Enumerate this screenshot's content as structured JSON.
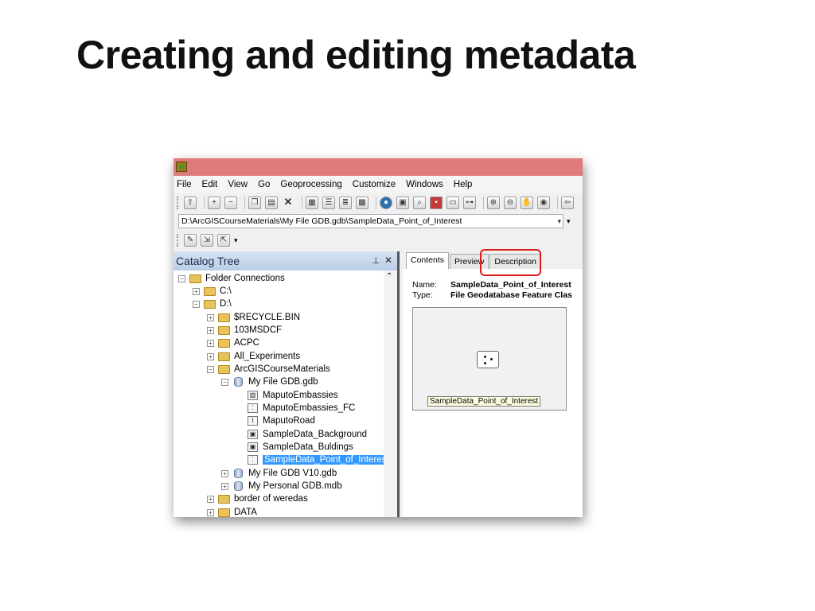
{
  "slide": {
    "title": "Creating and editing metadata"
  },
  "menu": [
    "File",
    "Edit",
    "View",
    "Go",
    "Geoprocessing",
    "Customize",
    "Windows",
    "Help"
  ],
  "location": {
    "path": "D:\\ArcGISCourseMaterials\\My File GDB.gdb\\SampleData_Point_of_Interest"
  },
  "catalog": {
    "title": "Catalog Tree",
    "items": [
      {
        "label": "Folder Connections"
      },
      {
        "label": "C:\\"
      },
      {
        "label": "D:\\"
      },
      {
        "label": "$RECYCLE.BIN"
      },
      {
        "label": "103MSDCF"
      },
      {
        "label": "ACPC"
      },
      {
        "label": "All_Experiments"
      },
      {
        "label": "ArcGISCourseMaterials"
      },
      {
        "label": "My File GDB.gdb"
      },
      {
        "label": "MaputoEmbassies"
      },
      {
        "label": "MaputoEmbassies_FC"
      },
      {
        "label": "MaputoRoad"
      },
      {
        "label": "SampleData_Background"
      },
      {
        "label": "SampleData_Buldings"
      },
      {
        "label": "SampleData_Point_of_Interest"
      },
      {
        "label": "My File GDB V10.gdb"
      },
      {
        "label": "My Personal GDB.mdb"
      },
      {
        "label": "border of weredas"
      },
      {
        "label": "DATA"
      }
    ]
  },
  "tabs": [
    "Contents",
    "Preview",
    "Description"
  ],
  "details": {
    "name_label": "Name:",
    "name_value": "SampleData_Point_of_Interest",
    "type_label": "Type:",
    "type_value": "File Geodatabase Feature Clas",
    "thumb_label": "SampleData_Point_of_Interest"
  }
}
